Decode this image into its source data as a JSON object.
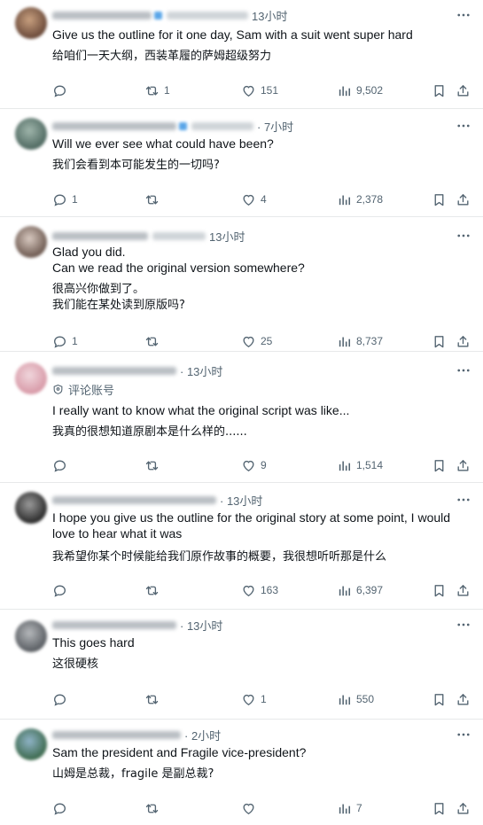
{
  "tweets": [
    {
      "time": "13小时",
      "en": "Give us the outline for it one day, Sam with a suit went super hard",
      "cn": "给咱们一天大纲，西装革履的萨姆超级努力",
      "en2": "",
      "cn2": "",
      "sub": "",
      "reply": "",
      "retweet": "1",
      "like": "151",
      "views": "9,502"
    },
    {
      "time": "· 7小时",
      "en": "Will we ever see what could have been?",
      "cn": "我们会看到本可能发生的一切吗?",
      "en2": "",
      "cn2": "",
      "sub": "",
      "reply": "1",
      "retweet": "",
      "like": "4",
      "views": "2,378"
    },
    {
      "time": "13小时",
      "en": "Glad you did.",
      "en2": "Can we read the original version somewhere?",
      "cn": "很高兴你做到了。",
      "cn2": "我们能在某处读到原版吗?",
      "sub": "",
      "reply": "1",
      "retweet": "",
      "like": "25",
      "views": "8,737"
    },
    {
      "time": "· 13小时",
      "sub": "评论账号",
      "en": "I really want to know what the original script was like...",
      "cn": "我真的很想知道原剧本是什么样的......",
      "en2": "",
      "cn2": "",
      "reply": "",
      "retweet": "",
      "like": "9",
      "views": "1,514"
    },
    {
      "time": "· 13小时",
      "en": "I hope you give us the outline for the original story at some point, I would",
      "en2": "love to hear what it was",
      "cn": "我希望你某个时候能给我们原作故事的概要，我很想听听那是什么",
      "cn2": "",
      "sub": "",
      "reply": "",
      "retweet": "",
      "like": "163",
      "views": "6,397"
    },
    {
      "time": "· 13小时",
      "en": "This goes hard",
      "cn": "这很硬核",
      "en2": "",
      "cn2": "",
      "sub": "",
      "reply": "",
      "retweet": "",
      "like": "1",
      "views": "550"
    },
    {
      "time": "· 2小时",
      "en": "Sam the president and Fragile vice-president?",
      "cn": "山姆是总裁，fragile 是副总裁?",
      "en2": "",
      "cn2": "",
      "sub": "",
      "reply": "",
      "retweet": "",
      "like": "",
      "views": "7"
    }
  ],
  "icons": {
    "reply": "reply-icon",
    "retweet": "retweet-icon",
    "like": "heart-icon",
    "views": "views-icon",
    "bookmark": "bookmark-icon",
    "share": "share-icon",
    "more": "more-icon",
    "sub": "eye-icon"
  },
  "colors": {
    "text": "#0f1419",
    "muted": "#536471",
    "divider": "#e7e9ea",
    "badge": "#5aa6e8"
  }
}
